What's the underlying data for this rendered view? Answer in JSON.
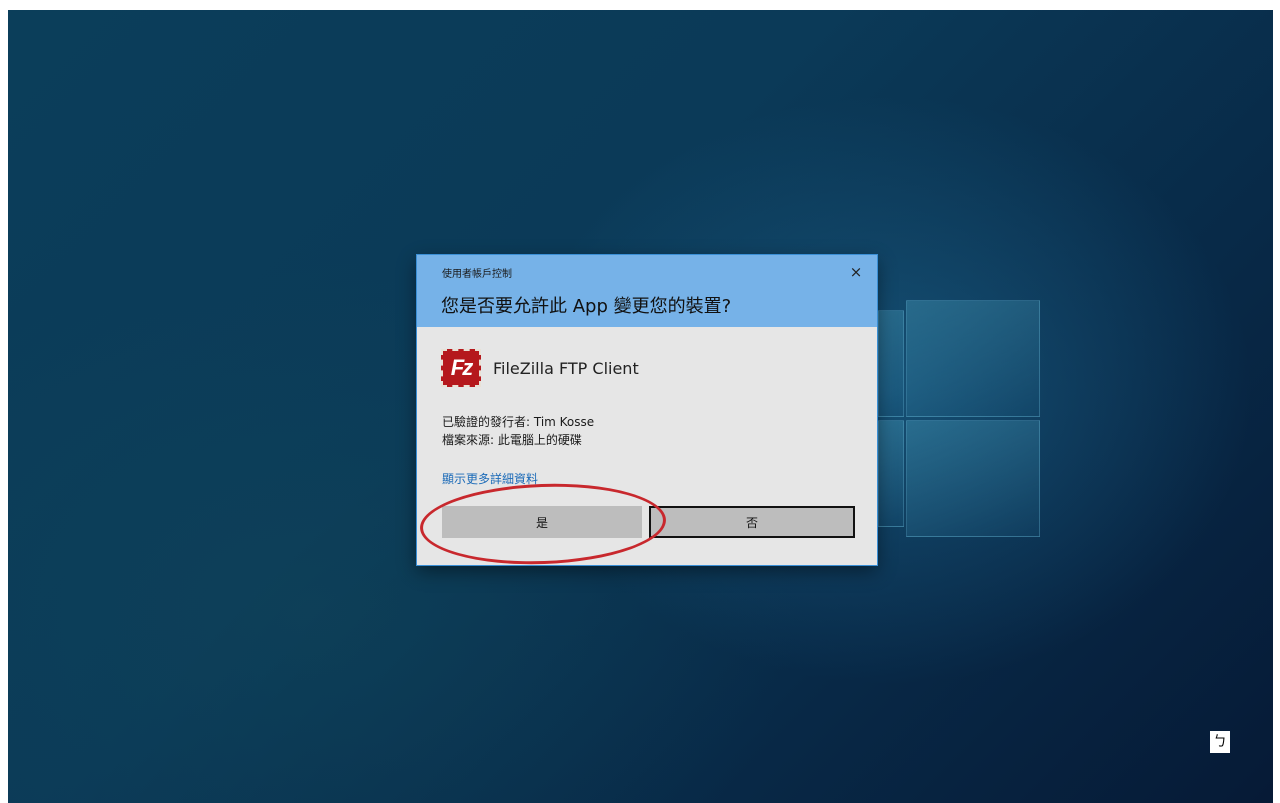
{
  "uac_dialog": {
    "window_title": "使用者帳戶控制",
    "question": "您是否要允許此 App 變更您的裝置?",
    "close_symbol": "×",
    "app_icon_text": "Fz",
    "app_name": "FileZilla FTP Client",
    "publisher_line": "已驗證的發行者: Tim Kosse",
    "origin_line": "檔案來源: 此電腦上的硬碟",
    "details_link": "顯示更多詳細資料",
    "yes_button": "是",
    "no_button": "否",
    "header_color": "#76b2e8",
    "body_color": "#e6e6e6",
    "link_color": "#1c6bb8"
  },
  "annotation": {
    "type": "red-ellipse",
    "color": "#c8282d",
    "target": "yes_button"
  },
  "corner_glyph": "ㄅ"
}
